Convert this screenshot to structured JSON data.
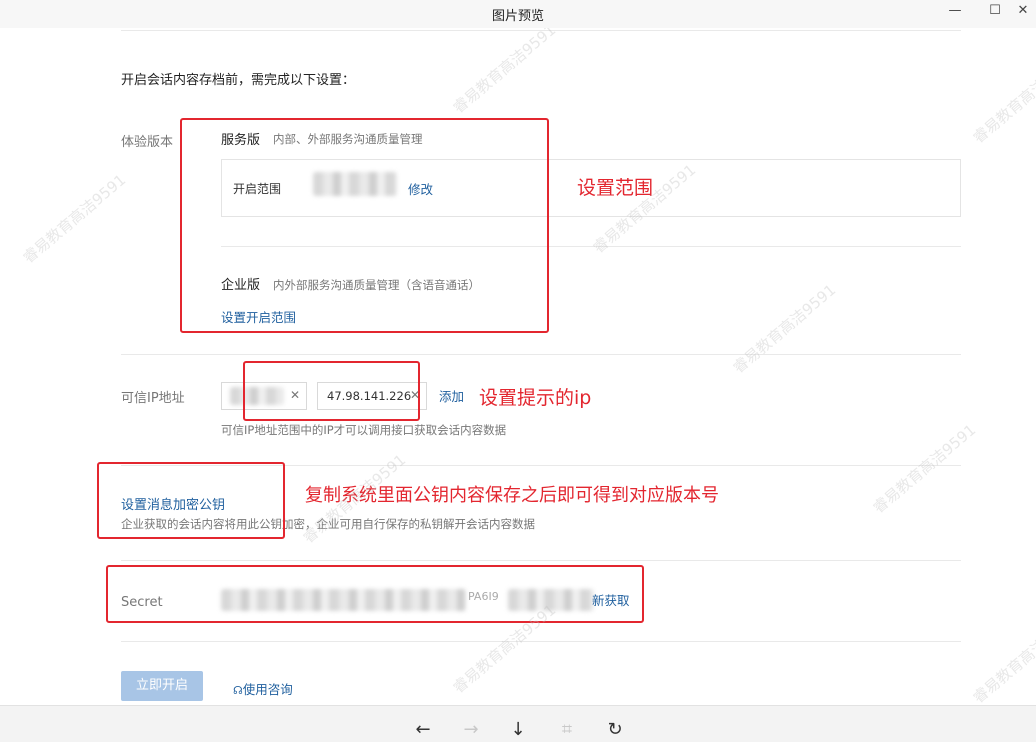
{
  "window": {
    "title": "图片预览",
    "minimize": "—",
    "maximize": "☐",
    "close": "✕"
  },
  "content": {
    "intro": "开启会话内容存档前，需完成以下设置：",
    "edition": {
      "label": "体验版本",
      "service": {
        "name": "服务版",
        "desc": "内部、外部服务沟通质量管理"
      },
      "scope_label": "开启范围",
      "modify_link": "修改",
      "enterprise": {
        "name": "企业版",
        "desc": "内外部服务沟通质量管理（含语音通话）"
      },
      "set_scope_link": "设置开启范围"
    },
    "ip": {
      "label": "可信IP地址",
      "ip_value": "47.98.141.226",
      "add_link": "添加",
      "hint": "可信IP地址范围中的IP才可以调用接口获取会话内容数据"
    },
    "key": {
      "title_link": "设置消息加密公钥",
      "hint": "企业获取的会话内容将用此公钥加密，企业可用自行保存的私钥解开会话内容数据"
    },
    "secret": {
      "label": "Secret",
      "partial_visible": "PA6I9",
      "refetch_link": "新获取"
    },
    "actions": {
      "enable_button": "立即开启",
      "consult_link": "使用咨询"
    }
  },
  "annotations": {
    "scope": "设置范围",
    "ip": "设置提示的ip",
    "key": "复制系统里面公钥内容保存之后即可得到对应版本号",
    "color": "#e3262f"
  },
  "watermark": {
    "text": "睿易教育高洁9591"
  },
  "toolbar": {
    "prev": "←",
    "next": "→",
    "download": "↓",
    "fit": "⌗",
    "rotate": "↻"
  }
}
